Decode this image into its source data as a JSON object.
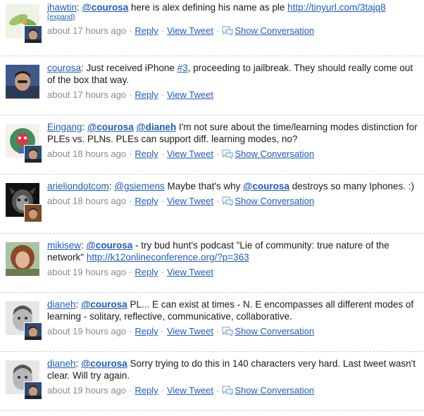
{
  "tweets": [
    {
      "user": "jhawtin",
      "segments": [
        {
          "t": ": ",
          "k": "text"
        },
        {
          "t": "@courosa",
          "k": "mention"
        },
        {
          "t": " here is alex defining his name as ple ",
          "k": "text"
        },
        {
          "t": "http://tinyurl.com/3tajq8",
          "k": "link"
        }
      ],
      "expand": "(expand)",
      "time": "about 17 hours ago",
      "reply": "Reply",
      "view": "View Tweet",
      "conv": "Show Conversation"
    },
    {
      "user": "courosa",
      "segments": [
        {
          "t": ": Just received iPhone ",
          "k": "text"
        },
        {
          "t": "#3",
          "k": "link"
        },
        {
          "t": ", proceeding to jailbreak. They should really come out of the box that way.",
          "k": "text"
        }
      ],
      "time": "about 17 hours ago",
      "reply": "Reply",
      "view": "View Tweet"
    },
    {
      "user": "Eingang",
      "segments": [
        {
          "t": ": ",
          "k": "text"
        },
        {
          "t": "@courosa",
          "k": "mention"
        },
        {
          "t": " ",
          "k": "text"
        },
        {
          "t": "@dianeh",
          "k": "mention"
        },
        {
          "t": " I'm not sure about the time/learning modes distinction for PLEs vs. PLNs. PLEs can support diff. learning modes, no?",
          "k": "text"
        }
      ],
      "time": "about 18 hours ago",
      "reply": "Reply",
      "view": "View Tweet",
      "conv": "Show Conversation"
    },
    {
      "user": "arieliondotcom",
      "segments": [
        {
          "t": ": ",
          "k": "text"
        },
        {
          "t": "@gsiemens",
          "k": "mention-plain"
        },
        {
          "t": " Maybe that's why ",
          "k": "text"
        },
        {
          "t": "@courosa",
          "k": "mention"
        },
        {
          "t": " destroys so many Iphones. :)",
          "k": "text"
        }
      ],
      "time": "about 18 hours ago",
      "reply": "Reply",
      "view": "View Tweet",
      "conv": "Show Conversation"
    },
    {
      "user": "mikisew",
      "segments": [
        {
          "t": ": ",
          "k": "text"
        },
        {
          "t": "@courosa",
          "k": "mention"
        },
        {
          "t": " - try bud hunt's podcast \"Lie of community: true nature of the network\" ",
          "k": "text"
        },
        {
          "t": "http://k12onlineconference.org/?p=363",
          "k": "link"
        }
      ],
      "time": "about 19 hours ago",
      "reply": "Reply",
      "view": "View Tweet"
    },
    {
      "user": "dianeh",
      "segments": [
        {
          "t": ": ",
          "k": "text"
        },
        {
          "t": "@courosa",
          "k": "mention"
        },
        {
          "t": " PL... E can exist at times - N. E encompasses all different modes of learning - solitary, reflective, communicative, collaborative.",
          "k": "text"
        }
      ],
      "time": "about 19 hours ago",
      "reply": "Reply",
      "view": "View Tweet",
      "conv": "Show Conversation"
    },
    {
      "user": "dianeh",
      "segments": [
        {
          "t": ": ",
          "k": "text"
        },
        {
          "t": "@courosa",
          "k": "mention"
        },
        {
          "t": " Sorry trying to do this in 140 characters very hard. Last tweet wasn't clear. Will try again.",
          "k": "text"
        }
      ],
      "time": "about 19 hours ago",
      "reply": "Reply",
      "view": "View Tweet",
      "conv": "Show Conversation"
    }
  ],
  "separator": "·"
}
